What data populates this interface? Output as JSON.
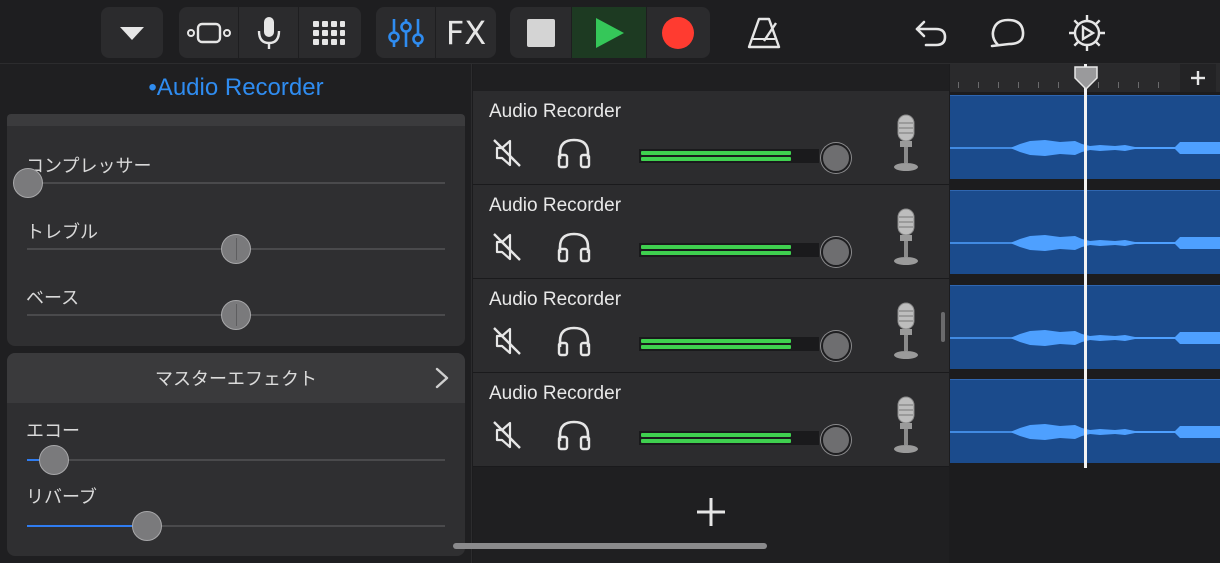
{
  "toolbar": {
    "fx_label": "FX"
  },
  "left_panel": {
    "title": "•Audio Recorder",
    "sliders_top": [
      {
        "label": "コンプレッサー",
        "value": 0.0
      },
      {
        "label": "トレブル",
        "value": 0.5
      },
      {
        "label": "ベース",
        "value": 0.5
      }
    ],
    "master_effect": {
      "title": "マスターエフェクト",
      "sliders": [
        {
          "label": "エコー",
          "value": 0.06
        },
        {
          "label": "リバーブ",
          "value": 0.29
        }
      ]
    }
  },
  "tracks": [
    {
      "name": "Audio Recorder",
      "level": 0.82
    },
    {
      "name": "Audio Recorder",
      "level": 0.82
    },
    {
      "name": "Audio Recorder",
      "level": 0.82
    },
    {
      "name": "Audio Recorder",
      "level": 0.82
    }
  ],
  "colors": {
    "accent": "#2f8cf0",
    "play": "#35c759",
    "record": "#ff3b30",
    "meter": "#3fd04f",
    "region": "#1b4b8c"
  }
}
